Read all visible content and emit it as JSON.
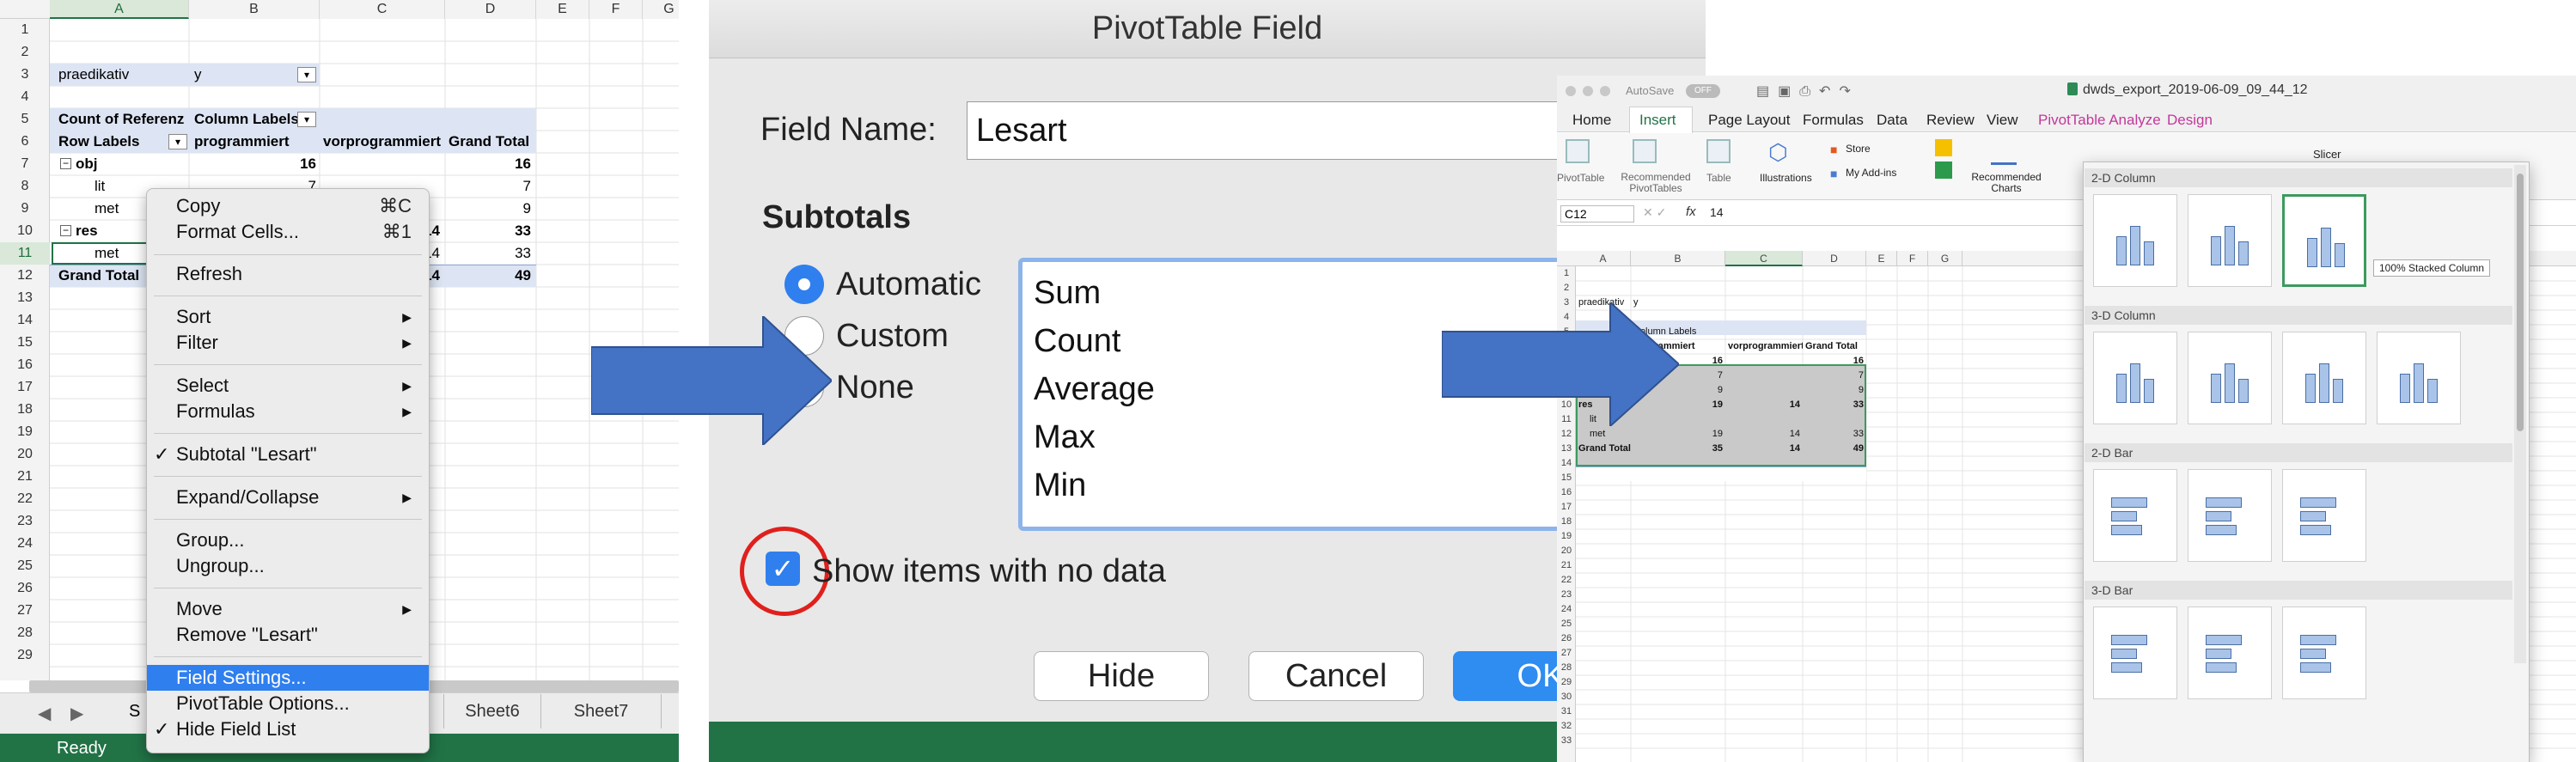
{
  "p1": {
    "col_headers": [
      "A",
      "B",
      "C",
      "D",
      "E",
      "F",
      "G"
    ],
    "row_numbers": [
      "1",
      "2",
      "3",
      "4",
      "5",
      "6",
      "7",
      "8",
      "9",
      "10",
      "11",
      "12",
      "13",
      "14",
      "15",
      "16",
      "17",
      "18",
      "19",
      "20",
      "21",
      "22",
      "23",
      "24",
      "25",
      "26",
      "27",
      "28",
      "29"
    ],
    "cells": {
      "a3": "praedikativ",
      "b3": "y",
      "a5": "Count of Referenz",
      "b5": "Column Labels",
      "a6": "Row Labels",
      "b6": "programmiert",
      "c6": "vorprogrammiert",
      "d6": "Grand Total",
      "a7": "obj",
      "b7": "16",
      "d7": "16",
      "a8": "lit",
      "b8": "7",
      "d8": "7",
      "a9": "met",
      "d9": "9",
      "a10": "res",
      "c10": "14",
      "d10": "33",
      "a11": "met",
      "c11": "14",
      "d11": "33",
      "a12": "Grand Total",
      "c12": "14",
      "d12": "49"
    },
    "sheet_tabs": [
      "Sheet6",
      "Sheet7"
    ],
    "sheet_tab_partial": "S",
    "status": "Ready",
    "menu": {
      "copy": "Copy",
      "copy_sc": "⌘C",
      "format": "Format Cells...",
      "format_sc": "⌘1",
      "refresh": "Refresh",
      "sort": "Sort",
      "filter": "Filter",
      "select": "Select",
      "formulas": "Formulas",
      "subtotal": "Subtotal \"Lesart\"",
      "expand": "Expand/Collapse",
      "group": "Group...",
      "ungroup": "Ungroup...",
      "move": "Move",
      "remove": "Remove \"Lesart\"",
      "field_settings": "Field Settings...",
      "pivot_options": "PivotTable Options...",
      "hide_field": "Hide Field List",
      "check": "✓",
      "arrow": "▶"
    }
  },
  "p2": {
    "title": "PivotTable Field",
    "field_name_label": "Field Name:",
    "field_name_value": "Lesart",
    "subtotals": "Subtotals",
    "radios": [
      "Automatic",
      "Custom",
      "None"
    ],
    "functions": [
      "Sum",
      "Count",
      "Average",
      "Max",
      "Min"
    ],
    "show_items": "Show items with no data",
    "hide": "Hide",
    "cancel": "Cancel",
    "ok": "OK"
  },
  "p3": {
    "autosave": "AutoSave",
    "autosave_state": "OFF",
    "filename": "dwds_export_2019-06-09_09_44_12",
    "tabs": [
      "Home",
      "Insert",
      "Page Layout",
      "Formulas",
      "Data",
      "Review",
      "View",
      "PivotTable Analyze",
      "Design"
    ],
    "ribbon": {
      "pivottable": "PivotTable",
      "recommended": "Recommended PivotTables",
      "table": "Table",
      "illustrations": "Illustrations",
      "store": "Store",
      "addins": "My Add-ins",
      "rec_charts": "Recommended Charts",
      "slicer": "Slicer"
    },
    "namebox": "C12",
    "fx": "fx",
    "formula": "14",
    "col_headers": [
      "A",
      "B",
      "C",
      "D",
      "E",
      "F",
      "G"
    ],
    "row_numbers": [
      "1",
      "2",
      "3",
      "4",
      "5",
      "6",
      "7",
      "8",
      "9",
      "10",
      "11",
      "12",
      "13",
      "14",
      "15",
      "16",
      "17",
      "18",
      "19",
      "20",
      "21",
      "22",
      "23",
      "24",
      "25",
      "26",
      "27",
      "28",
      "29",
      "30",
      "31",
      "32",
      "33"
    ],
    "cells": {
      "a3": "praedikativ",
      "b3": "y",
      "b5": "Column Labels",
      "b6": "programmiert",
      "c6": "vorprogrammiert",
      "d6": "Grand Total",
      "b7": "16",
      "d7": "16",
      "b8": "7",
      "d8": "7",
      "b9": "9",
      "d9": "9",
      "a9": "me",
      "a10": "res",
      "b10": "19",
      "c10": "14",
      "d10": "33",
      "a11": "lit",
      "a12": "met",
      "b12": "19",
      "c12": "14",
      "d12": "33",
      "a13": "Grand Total",
      "b13": "35",
      "c13": "14",
      "d13": "49"
    },
    "gallery": {
      "col2d": "2-D Column",
      "col3d": "3-D Column",
      "bar2d": "2-D Bar",
      "bar3d": "3-D Bar",
      "tooltip": "100% Stacked Column"
    }
  },
  "colors": {
    "excel_green": "#217346",
    "accent_blue": "#4472c4",
    "menu_sel": "#2f7fef",
    "red_circle": "#e0201c",
    "pivot_tab": "#c3379a"
  }
}
